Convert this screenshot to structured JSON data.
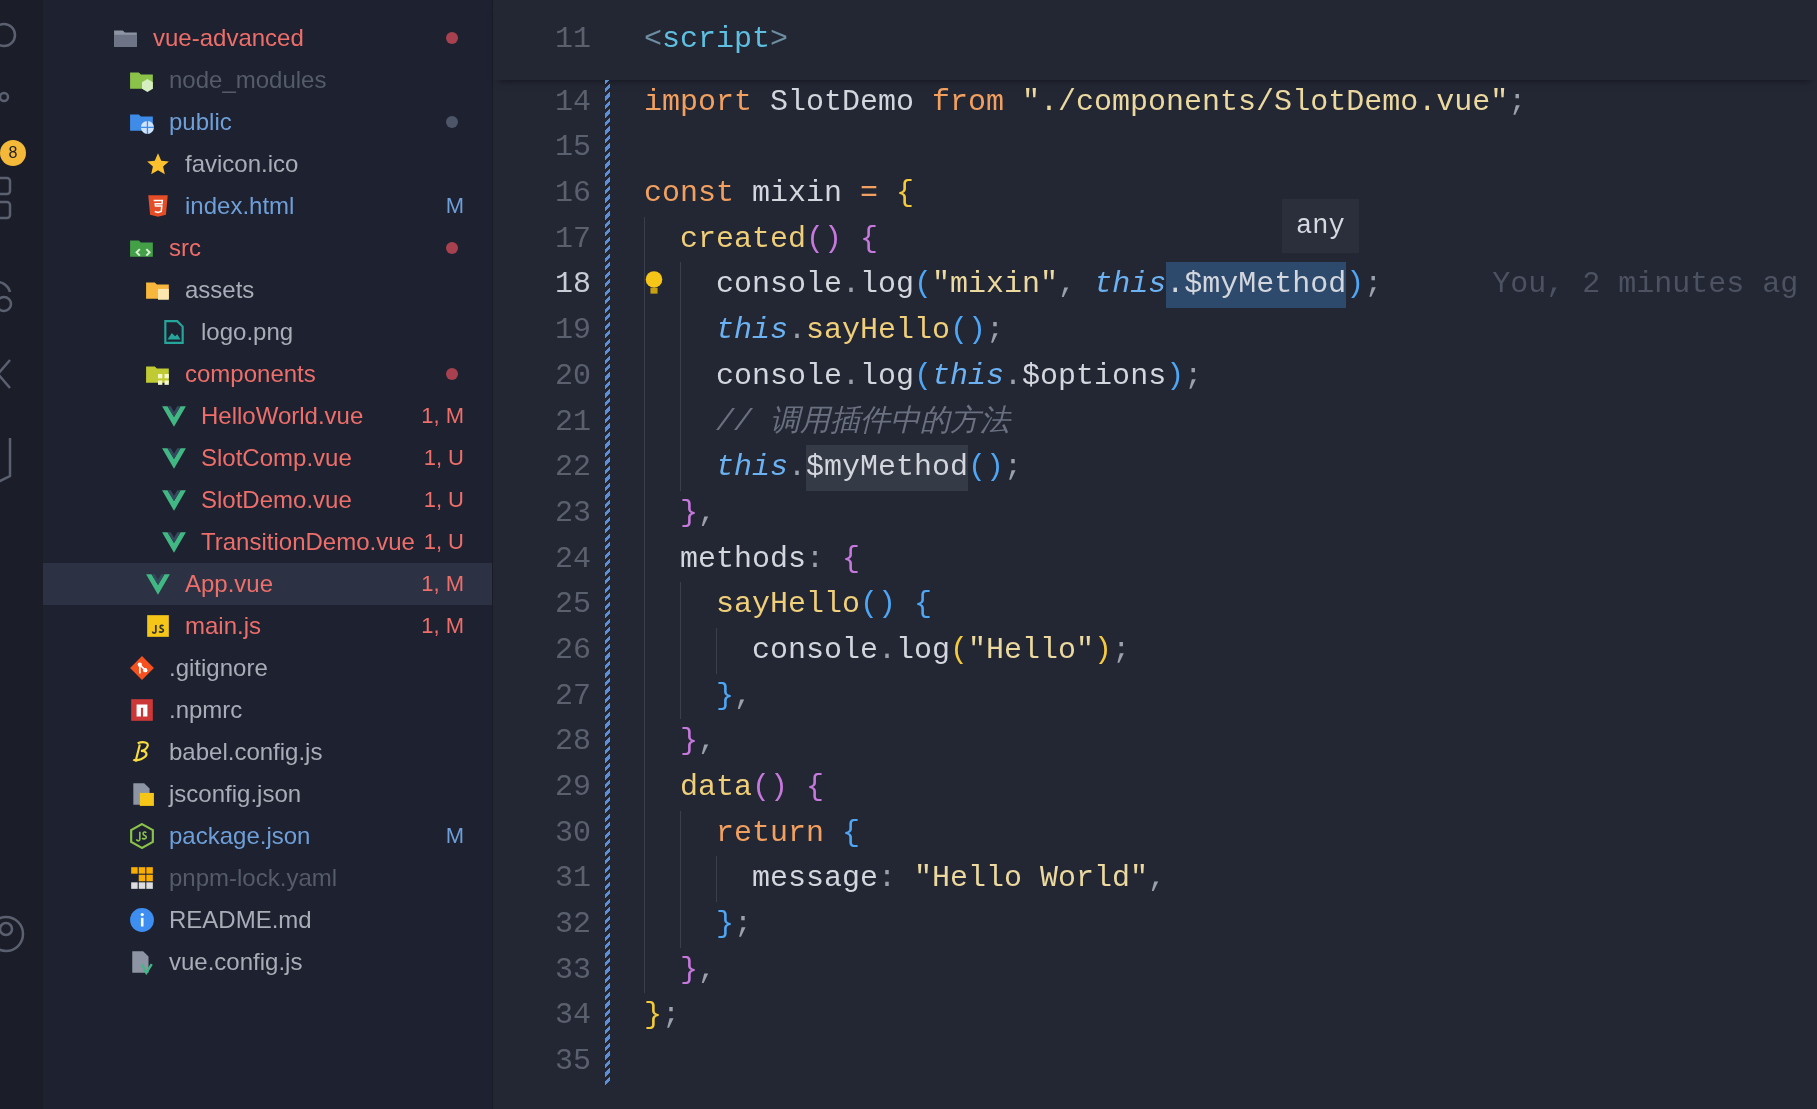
{
  "activity_bar": {
    "badge": "8"
  },
  "explorer": {
    "items": [
      {
        "name": "vue-advanced",
        "kind": "folder",
        "errors": true,
        "dot": true,
        "selected": false,
        "children": [
          {
            "name": "node_modules",
            "kind": "folder-node",
            "errors": false,
            "ignored": true,
            "dot": false,
            "selected": false
          },
          {
            "name": "public",
            "kind": "folder-globe",
            "errors": false,
            "ignored": false,
            "modified": true,
            "dot": true,
            "selected": false,
            "children": [
              {
                "name": "favicon.ico",
                "kind": "star",
                "errors": false,
                "ignored": false,
                "modified": false,
                "dot": false,
                "selected": false
              },
              {
                "name": "index.html",
                "kind": "html",
                "errors": false,
                "ignored": false,
                "modified": true,
                "dot": false,
                "selected": false,
                "status": "M"
              }
            ]
          },
          {
            "name": "src",
            "kind": "folder-code",
            "errors": true,
            "dot": true,
            "selected": false,
            "children": [
              {
                "name": "assets",
                "kind": "folder-assets",
                "errors": false,
                "ignored": false,
                "modified": false,
                "dot": false,
                "selected": false,
                "children": [
                  {
                    "name": "logo.png",
                    "kind": "image",
                    "errors": false,
                    "ignored": false,
                    "modified": false,
                    "dot": false,
                    "selected": false
                  }
                ]
              },
              {
                "name": "components",
                "kind": "folder-components",
                "errors": true,
                "dot": true,
                "selected": false,
                "children": [
                  {
                    "name": "HelloWorld.vue",
                    "kind": "vue",
                    "errors": true,
                    "dot": false,
                    "selected": false,
                    "status": "1, M"
                  },
                  {
                    "name": "SlotComp.vue",
                    "kind": "vue",
                    "errors": true,
                    "dot": false,
                    "selected": false,
                    "status": "1, U"
                  },
                  {
                    "name": "SlotDemo.vue",
                    "kind": "vue",
                    "errors": true,
                    "dot": false,
                    "selected": false,
                    "status": "1, U"
                  },
                  {
                    "name": "TransitionDemo.vue",
                    "kind": "vue",
                    "errors": true,
                    "dot": false,
                    "selected": false,
                    "status": "1, U"
                  }
                ]
              },
              {
                "name": "App.vue",
                "kind": "vue",
                "errors": true,
                "dot": false,
                "selected": true,
                "status": "1, M"
              },
              {
                "name": "main.js",
                "kind": "js",
                "errors": true,
                "dot": false,
                "selected": false,
                "status": "1, M"
              }
            ]
          },
          {
            "name": ".gitignore",
            "kind": "git",
            "errors": false,
            "ignored": false,
            "modified": false,
            "dot": false,
            "selected": false
          },
          {
            "name": ".npmrc",
            "kind": "npm",
            "errors": false,
            "ignored": false,
            "modified": false,
            "dot": false,
            "selected": false
          },
          {
            "name": "babel.config.js",
            "kind": "babel",
            "errors": false,
            "ignored": false,
            "modified": false,
            "dot": false,
            "selected": false
          },
          {
            "name": "jsconfig.json",
            "kind": "jsconfig",
            "errors": false,
            "ignored": false,
            "modified": false,
            "dot": false,
            "selected": false
          },
          {
            "name": "package.json",
            "kind": "node",
            "errors": false,
            "ignored": false,
            "modified": true,
            "dot": false,
            "selected": false,
            "status": "M"
          },
          {
            "name": "pnpm-lock.yaml",
            "kind": "pnpm",
            "errors": false,
            "ignored": true,
            "dot": false,
            "selected": false
          },
          {
            "name": "README.md",
            "kind": "info",
            "errors": false,
            "ignored": false,
            "modified": false,
            "dot": false,
            "selected": false
          },
          {
            "name": "vue.config.js",
            "kind": "vue-config",
            "errors": false,
            "ignored": false,
            "modified": false,
            "dot": false,
            "selected": false
          }
        ]
      }
    ]
  },
  "editor": {
    "sticky": [
      {
        "number": "11",
        "tokens": [
          {
            "t": "<",
            "kind": "tagp"
          },
          {
            "t": "script",
            "kind": "tag"
          },
          {
            "t": ">",
            "kind": "tagp"
          }
        ]
      }
    ],
    "lines": [
      {
        "number": "14",
        "tokens": [
          {
            "t": "import",
            "kind": "kw"
          },
          {
            "t": " SlotDemo ",
            "kind": "id"
          },
          {
            "t": "from",
            "kind": "kw"
          },
          {
            "t": " \"./components/SlotDemo.vue\"",
            "kind": "str"
          },
          {
            "t": ";",
            "kind": "p"
          }
        ]
      },
      {
        "number": "15"
      },
      {
        "number": "16",
        "tokens": [
          {
            "t": "const",
            "kind": "kw"
          },
          {
            "t": " mixin ",
            "kind": "id"
          },
          {
            "t": "=",
            "kind": "kw"
          },
          {
            "t": " {",
            "kind": "b1"
          }
        ]
      },
      {
        "number": "17",
        "tokens": [
          {
            "t": "  created",
            "kind": "fn"
          },
          {
            "t": "()",
            "kind": "b2"
          },
          {
            "t": " {",
            "kind": "b2"
          }
        ]
      },
      {
        "number": "18",
        "current": true,
        "hint": true,
        "blame": "You, 2 minutes ag",
        "tokens": [
          {
            "t": "    console",
            "kind": "id"
          },
          {
            "t": ".",
            "kind": "p"
          },
          {
            "t": "log",
            "kind": "id"
          },
          {
            "t": "(",
            "kind": "b3"
          },
          {
            "t": "\"mixin\"",
            "kind": "str"
          },
          {
            "t": ", ",
            "kind": "p"
          },
          {
            "t": "this",
            "kind": "this"
          },
          {
            "t": ".$myMethod",
            "kind": "id",
            "selected": true
          },
          {
            "t": ")",
            "kind": "b3"
          },
          {
            "t": ";",
            "kind": "p"
          }
        ]
      },
      {
        "number": "19",
        "tokens": [
          {
            "t": "    this",
            "kind": "this"
          },
          {
            "t": ".",
            "kind": "p"
          },
          {
            "t": "sayHello",
            "kind": "fn"
          },
          {
            "t": "()",
            "kind": "b3"
          },
          {
            "t": ";",
            "kind": "p"
          }
        ]
      },
      {
        "number": "20",
        "tokens": [
          {
            "t": "    console",
            "kind": "id"
          },
          {
            "t": ".",
            "kind": "p"
          },
          {
            "t": "log",
            "kind": "id"
          },
          {
            "t": "(",
            "kind": "b3"
          },
          {
            "t": "this",
            "kind": "this"
          },
          {
            "t": ".",
            "kind": "p"
          },
          {
            "t": "$options",
            "kind": "id"
          },
          {
            "t": ")",
            "kind": "b3"
          },
          {
            "t": ";",
            "kind": "p"
          }
        ]
      },
      {
        "number": "21",
        "tokens": [
          {
            "t": "    // 调用插件中的方法",
            "kind": "cm"
          }
        ]
      },
      {
        "number": "22",
        "tokens": [
          {
            "t": "    this",
            "kind": "this"
          },
          {
            "t": ".",
            "kind": "p"
          },
          {
            "t": "$myMethod",
            "kind": "id",
            "highlighted": true
          },
          {
            "t": "()",
            "kind": "b3"
          },
          {
            "t": ";",
            "kind": "p"
          }
        ]
      },
      {
        "number": "23",
        "tokens": [
          {
            "t": "  }",
            "kind": "b2"
          },
          {
            "t": ",",
            "kind": "p"
          }
        ]
      },
      {
        "number": "24",
        "tokens": [
          {
            "t": "  methods",
            "kind": "id"
          },
          {
            "t": ": ",
            "kind": "p"
          },
          {
            "t": "{",
            "kind": "b2"
          }
        ]
      },
      {
        "number": "25",
        "tokens": [
          {
            "t": "    sayHello",
            "kind": "fn"
          },
          {
            "t": "()",
            "kind": "b3"
          },
          {
            "t": " {",
            "kind": "b3"
          }
        ]
      },
      {
        "number": "26",
        "tokens": [
          {
            "t": "      console",
            "kind": "id"
          },
          {
            "t": ".",
            "kind": "p"
          },
          {
            "t": "log",
            "kind": "id"
          },
          {
            "t": "(",
            "kind": "b1"
          },
          {
            "t": "\"Hello\"",
            "kind": "str"
          },
          {
            "t": ")",
            "kind": "b1"
          },
          {
            "t": ";",
            "kind": "p"
          }
        ]
      },
      {
        "number": "27",
        "tokens": [
          {
            "t": "    }",
            "kind": "b3"
          },
          {
            "t": ",",
            "kind": "p"
          }
        ]
      },
      {
        "number": "28",
        "tokens": [
          {
            "t": "  }",
            "kind": "b2"
          },
          {
            "t": ",",
            "kind": "p"
          }
        ]
      },
      {
        "number": "29",
        "tokens": [
          {
            "t": "  data",
            "kind": "fn"
          },
          {
            "t": "()",
            "kind": "b2"
          },
          {
            "t": " {",
            "kind": "b2"
          }
        ]
      },
      {
        "number": "30",
        "tokens": [
          {
            "t": "    return",
            "kind": "kw"
          },
          {
            "t": " {",
            "kind": "b3"
          }
        ]
      },
      {
        "number": "31",
        "tokens": [
          {
            "t": "      message",
            "kind": "id"
          },
          {
            "t": ": ",
            "kind": "p"
          },
          {
            "t": "\"Hello World\"",
            "kind": "str"
          },
          {
            "t": ",",
            "kind": "p"
          }
        ]
      },
      {
        "number": "32",
        "tokens": [
          {
            "t": "    }",
            "kind": "b3"
          },
          {
            "t": ";",
            "kind": "p"
          }
        ]
      },
      {
        "number": "33",
        "tokens": [
          {
            "t": "  }",
            "kind": "b2"
          },
          {
            "t": ",",
            "kind": "p"
          }
        ]
      },
      {
        "number": "34",
        "tokens": [
          {
            "t": "}",
            "kind": "b1"
          },
          {
            "t": ";",
            "kind": "p"
          }
        ]
      },
      {
        "number": "35"
      }
    ],
    "hover": {
      "text": "any"
    }
  }
}
